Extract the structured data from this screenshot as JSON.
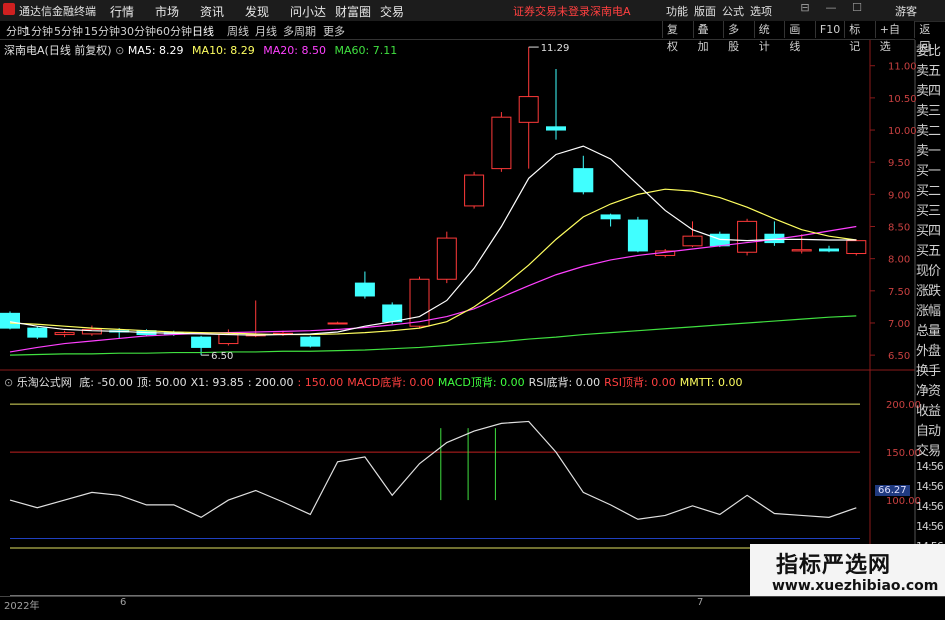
{
  "app": {
    "title": "通达信金融终端",
    "warning": "证券交易未登录",
    "stock_name": "深南电A",
    "guest": "游客",
    "L": "L"
  },
  "menu": [
    "行情",
    "市场",
    "资讯",
    "发现",
    "问小达",
    "财富圈",
    "交易"
  ],
  "right_menu": [
    "功能",
    "版面",
    "公式",
    "选项"
  ],
  "periods": [
    "分时",
    "1分钟",
    "5分钟",
    "15分钟",
    "30分钟",
    "60分钟",
    "日线",
    "周线",
    "月线",
    "多周期",
    "更多"
  ],
  "active_period": "日线",
  "tools": [
    "复权",
    "叠加",
    "多股",
    "统计",
    "画线",
    "F10",
    "标记",
    "+自选",
    "返回"
  ],
  "main_header": {
    "stock": "深南电A(日线 前复权)",
    "ma5": "MA5: 8.29",
    "ma10": "MA10: 8.29",
    "ma20": "MA20: 8.50",
    "ma60": "MA60: 7.11"
  },
  "sub_header": {
    "name": "乐淘公式网",
    "items": [
      "底: -50.00",
      "顶: 50.00",
      "X1: 93.85",
      ": 200.00",
      ": 150.00",
      "MACD底背: 0.00",
      "MACD顶背: 0.00",
      "RSI底背: 0.00",
      "RSI顶背: 0.00",
      "MMTT: 0.00"
    ]
  },
  "colors": {
    "up": "#ff3a3a",
    "down": "#40ffff",
    "ma5": "#ffffff",
    "ma10": "#ffff60",
    "ma20": "#ff40ff",
    "ma60": "#40e040"
  },
  "price_axis": [
    "11.00",
    "10.50",
    "10.00",
    "9.50",
    "9.00",
    "8.50",
    "8.00",
    "7.50",
    "7.00",
    "6.50"
  ],
  "annotations": {
    "high": "11.29",
    "low": "6.50"
  },
  "indicator_axis": [
    "200.00",
    "150.00",
    "100.00",
    "50.00"
  ],
  "indicator_value": "66.27",
  "right_panel": [
    "委比",
    "卖五",
    "卖四",
    "卖三",
    "卖二",
    "卖一",
    "买一",
    "买二",
    "买三",
    "买四",
    "买五",
    "现价",
    "涨跌",
    "涨幅",
    "总量",
    "外盘",
    "换手",
    "净资",
    "收益",
    "自动",
    "交易",
    "14:56",
    "14:56",
    "14:56",
    "14:56",
    "14:56",
    "14:56",
    "14:56",
    "14:56"
  ],
  "bottom_axis": [
    "2022年",
    "6",
    "7"
  ],
  "watermark": {
    "line1": "指标严选网",
    "line2": "www.xuezhibiao.com"
  },
  "chart_data": {
    "type": "candlestick",
    "price_range": [
      6.3,
      11.4
    ],
    "candles": [
      [
        7.15,
        6.92,
        7.18,
        6.9
      ],
      [
        6.92,
        6.78,
        6.95,
        6.75
      ],
      [
        6.82,
        6.85,
        6.88,
        6.78
      ],
      [
        6.83,
        6.9,
        6.96,
        6.8
      ],
      [
        6.88,
        6.86,
        6.92,
        6.76
      ],
      [
        6.88,
        6.82,
        6.9,
        6.8
      ],
      [
        6.85,
        6.83,
        6.88,
        6.8
      ],
      [
        6.78,
        6.62,
        6.8,
        6.5
      ],
      [
        6.68,
        6.82,
        6.9,
        6.65
      ],
      [
        6.8,
        6.82,
        7.35,
        6.78
      ],
      [
        6.83,
        6.84,
        6.88,
        6.8
      ],
      [
        6.78,
        6.64,
        6.8,
        6.62
      ],
      [
        7.0,
        7.0,
        7.02,
        6.98
      ],
      [
        7.62,
        7.42,
        7.8,
        7.38
      ],
      [
        7.28,
        7.02,
        7.32,
        6.98
      ],
      [
        6.95,
        7.68,
        7.72,
        6.92
      ],
      [
        7.68,
        8.32,
        8.42,
        7.62
      ],
      [
        8.82,
        9.3,
        9.35,
        8.78
      ],
      [
        9.4,
        10.2,
        10.28,
        9.35
      ],
      [
        10.12,
        10.52,
        11.29,
        9.4
      ],
      [
        10.05,
        10.0,
        10.95,
        9.85
      ],
      [
        9.4,
        9.04,
        9.6,
        9.0
      ],
      [
        8.68,
        8.62,
        8.7,
        8.5
      ],
      [
        8.6,
        8.12,
        8.65,
        8.1
      ],
      [
        8.05,
        8.12,
        8.15,
        8.02
      ],
      [
        8.2,
        8.35,
        8.58,
        8.18
      ],
      [
        8.38,
        8.2,
        8.42,
        8.18
      ],
      [
        8.1,
        8.58,
        8.62,
        8.05
      ],
      [
        8.38,
        8.25,
        8.58,
        8.2
      ],
      [
        8.12,
        8.14,
        8.38,
        8.08
      ],
      [
        8.15,
        8.12,
        8.2,
        8.1
      ],
      [
        8.08,
        8.28,
        8.3,
        8.05
      ]
    ],
    "ma5": [
      7.02,
      6.95,
      6.9,
      6.88,
      6.87,
      6.85,
      6.84,
      6.83,
      6.82,
      6.81,
      6.82,
      6.83,
      6.86,
      6.95,
      7.02,
      7.1,
      7.35,
      7.85,
      8.5,
      9.25,
      9.62,
      9.75,
      9.55,
      9.15,
      8.75,
      8.45,
      8.3,
      8.28,
      8.3,
      8.3,
      8.29,
      8.29
    ],
    "ma10": [
      7.0,
      6.98,
      6.95,
      6.92,
      6.9,
      6.88,
      6.86,
      6.85,
      6.84,
      6.83,
      6.82,
      6.82,
      6.83,
      6.85,
      6.88,
      6.92,
      7.02,
      7.25,
      7.55,
      7.9,
      8.3,
      8.65,
      8.85,
      9.0,
      9.08,
      9.05,
      8.95,
      8.8,
      8.62,
      8.45,
      8.35,
      8.29
    ],
    "ma20": [
      6.55,
      6.62,
      6.68,
      6.72,
      6.76,
      6.8,
      6.82,
      6.84,
      6.85,
      6.86,
      6.87,
      6.88,
      6.9,
      6.93,
      6.97,
      7.02,
      7.1,
      7.22,
      7.4,
      7.58,
      7.75,
      7.88,
      7.98,
      8.05,
      8.1,
      8.15,
      8.2,
      8.25,
      8.3,
      8.36,
      8.43,
      8.5
    ],
    "ma60": [
      6.5,
      6.51,
      6.52,
      6.52,
      6.53,
      6.53,
      6.54,
      6.54,
      6.55,
      6.55,
      6.56,
      6.56,
      6.57,
      6.58,
      6.6,
      6.62,
      6.65,
      6.68,
      6.71,
      6.75,
      6.78,
      6.82,
      6.85,
      6.88,
      6.91,
      6.94,
      6.97,
      7.0,
      7.03,
      7.06,
      7.09,
      7.11
    ],
    "indicator": {
      "range": [
        0,
        220
      ],
      "levels": [
        200,
        150,
        50
      ],
      "line": [
        100,
        92,
        100,
        108,
        105,
        95,
        95,
        82,
        100,
        110,
        98,
        85,
        140,
        145,
        105,
        138,
        160,
        172,
        180,
        182,
        150,
        108,
        95,
        80,
        84,
        94,
        85,
        105,
        86,
        84,
        82,
        92
      ],
      "signals": [
        16,
        17,
        18
      ]
    }
  }
}
